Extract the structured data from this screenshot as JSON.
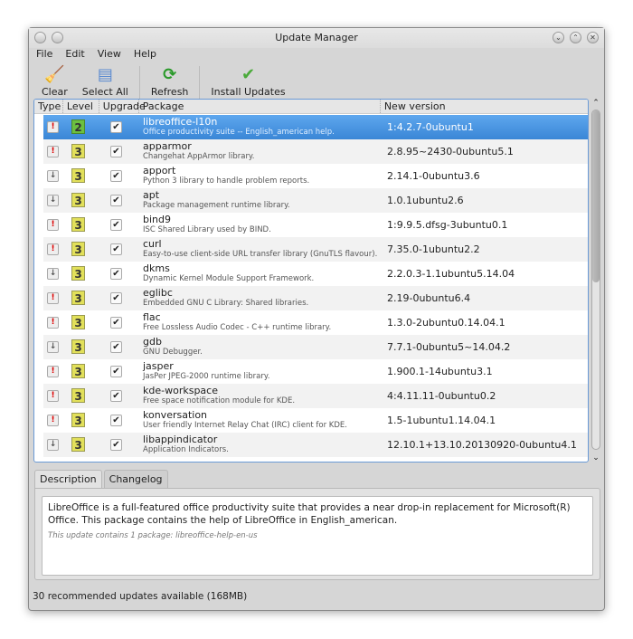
{
  "window": {
    "title": "Update Manager"
  },
  "menu": [
    "File",
    "Edit",
    "View",
    "Help"
  ],
  "toolbar": {
    "clear": "Clear",
    "select_all": "Select All",
    "refresh": "Refresh",
    "install": "Install Updates"
  },
  "columns": {
    "type": "Type",
    "level": "Level",
    "upgrade": "Upgrade",
    "package": "Package",
    "version": "New version"
  },
  "packages": [
    {
      "name": "libreoffice-l10n",
      "desc": "Office productivity suite -- English_american help.",
      "version": "1:4.2.7-0ubuntu1",
      "type": "security",
      "level": "2",
      "checked": true,
      "selected": true
    },
    {
      "name": "apparmor",
      "desc": "Changehat AppArmor library.",
      "version": "2.8.95~2430-0ubuntu5.1",
      "type": "security",
      "level": "3",
      "checked": true
    },
    {
      "name": "apport",
      "desc": "Python 3 library to handle problem reports.",
      "version": "2.14.1-0ubuntu3.6",
      "type": "normal",
      "level": "3",
      "checked": true
    },
    {
      "name": "apt",
      "desc": "Package management runtime library.",
      "version": "1.0.1ubuntu2.6",
      "type": "normal",
      "level": "3",
      "checked": true
    },
    {
      "name": "bind9",
      "desc": "ISC Shared Library used by BIND.",
      "version": "1:9.9.5.dfsg-3ubuntu0.1",
      "type": "security",
      "level": "3",
      "checked": true
    },
    {
      "name": "curl",
      "desc": "Easy-to-use client-side URL transfer library (GnuTLS flavour).",
      "version": "7.35.0-1ubuntu2.2",
      "type": "security",
      "level": "3",
      "checked": true
    },
    {
      "name": "dkms",
      "desc": "Dynamic Kernel Module Support Framework.",
      "version": "2.2.0.3-1.1ubuntu5.14.04",
      "type": "normal",
      "level": "3",
      "checked": true
    },
    {
      "name": "eglibc",
      "desc": "Embedded GNU C Library: Shared libraries.",
      "version": "2.19-0ubuntu6.4",
      "type": "security",
      "level": "3",
      "checked": true
    },
    {
      "name": "flac",
      "desc": "Free Lossless Audio Codec - C++ runtime library.",
      "version": "1.3.0-2ubuntu0.14.04.1",
      "type": "security",
      "level": "3",
      "checked": true
    },
    {
      "name": "gdb",
      "desc": "GNU Debugger.",
      "version": "7.7.1-0ubuntu5~14.04.2",
      "type": "normal",
      "level": "3",
      "checked": true
    },
    {
      "name": "jasper",
      "desc": "JasPer JPEG-2000 runtime library.",
      "version": "1.900.1-14ubuntu3.1",
      "type": "security",
      "level": "3",
      "checked": true
    },
    {
      "name": "kde-workspace",
      "desc": "Free space notification module for KDE.",
      "version": "4:4.11.11-0ubuntu0.2",
      "type": "security",
      "level": "3",
      "checked": true
    },
    {
      "name": "konversation",
      "desc": "User friendly Internet Relay Chat (IRC) client for KDE.",
      "version": "1.5-1ubuntu1.14.04.1",
      "type": "security",
      "level": "3",
      "checked": true
    },
    {
      "name": "libappindicator",
      "desc": "Application Indicators.",
      "version": "12.10.1+13.10.20130920-0ubuntu4.1",
      "type": "normal",
      "level": "3",
      "checked": true
    }
  ],
  "tabs": {
    "description": "Description",
    "changelog": "Changelog"
  },
  "details": {
    "text": "LibreOffice is a full-featured office productivity suite that provides a near drop-in replacement for Microsoft(R) Office. This package contains the help of LibreOffice in English_american.",
    "note": "This update contains 1 package:  libreoffice-help-en-us"
  },
  "status": "30 recommended updates available (168MB)",
  "scroll_fraction": 0
}
